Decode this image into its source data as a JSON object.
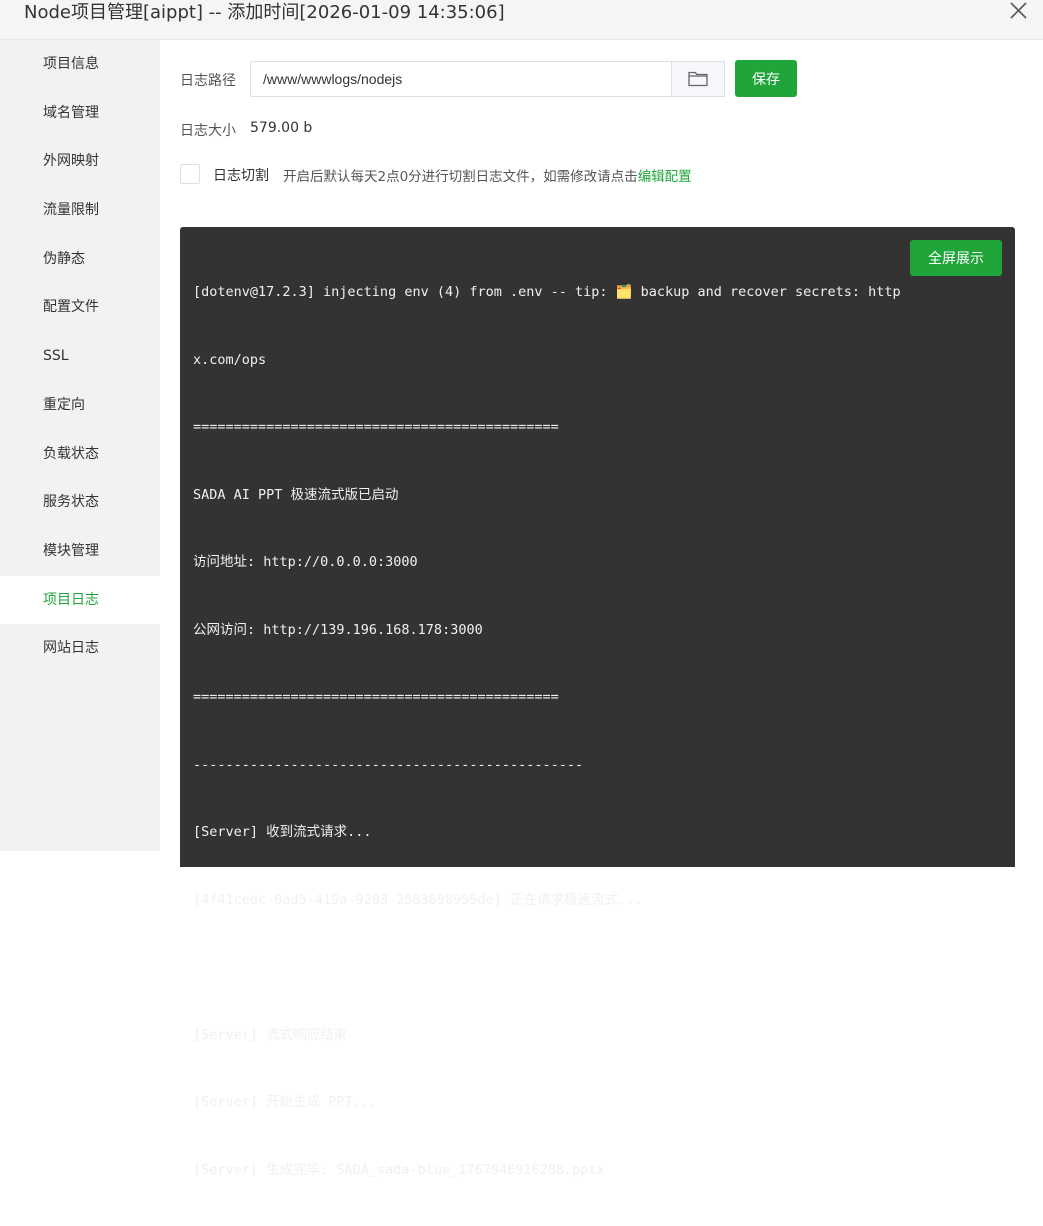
{
  "window": {
    "title": "Node项目管理[aippt] -- 添加时间[2026-01-09 14:35:06]"
  },
  "sidebar": {
    "items": [
      {
        "label": "项目信息"
      },
      {
        "label": "域名管理"
      },
      {
        "label": "外网映射"
      },
      {
        "label": "流量限制"
      },
      {
        "label": "伪静态"
      },
      {
        "label": "配置文件"
      },
      {
        "label": "SSL"
      },
      {
        "label": "重定向"
      },
      {
        "label": "负载状态"
      },
      {
        "label": "服务状态"
      },
      {
        "label": "模块管理"
      },
      {
        "label": "项目日志"
      },
      {
        "label": "网站日志"
      }
    ],
    "active": "项目日志"
  },
  "log_settings": {
    "path_label": "日志路径",
    "path_value": "/www/wwwlogs/nodejs",
    "save_label": "保存",
    "size_label": "日志大小",
    "size_value": "579.00 b",
    "rotate_label": "日志切割",
    "rotate_desc": "开启后默认每天2点0分进行切割日志文件，如需修改请点击",
    "rotate_link": "编辑配置",
    "rotate_checked": false
  },
  "console": {
    "fullscreen_label": "全屏展示",
    "lines": [
      "[dotenv@17.2.3] injecting env (4) from .env -- tip: 🗂️ backup and recover secrets: http",
      "x.com/ops",
      "=============================================",
      "SADA AI PPT 极速流式版已启动",
      "访问地址: http://0.0.0.0:3000",
      "公网访问: http://139.196.168.178:3000",
      "=============================================",
      "------------------------------------------------",
      "[Server] 收到流式请求...",
      "[4f41cedc-0ad5-419a-9203-2583698955de] 正在请求极速流式...",
      "",
      "[Server] 流式响应结束",
      "[Server] 开始生成 PPT...",
      "[Server] 生成完毕: SADA_sada-blue_1767946916288.pptx"
    ]
  },
  "colors": {
    "accent": "#20a53a",
    "console_bg": "#333333",
    "sidebar_bg": "#f2f2f2"
  },
  "icons": {
    "close": "close-icon",
    "folder": "folder-icon"
  }
}
